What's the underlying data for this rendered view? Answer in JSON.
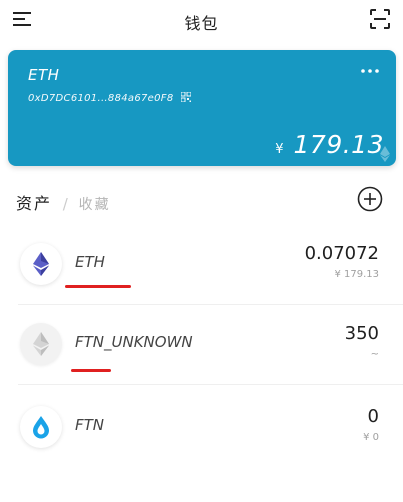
{
  "header": {
    "title": "钱包"
  },
  "wallet": {
    "name": "ETH",
    "address": "0xD7DC6101...884a67e0F8",
    "currency_symbol": "¥",
    "balance": "179.13"
  },
  "assets_section": {
    "tab_assets": "资产",
    "separator": "/",
    "tab_favorites": "收藏"
  },
  "tokens": [
    {
      "name": "ETH",
      "amount": "0.07072",
      "value": "¥  179.13",
      "icon": "ethereum-icon"
    },
    {
      "name": "FTN_UNKNOWN",
      "amount": "350",
      "value": "~",
      "icon": "ethereum-gray-icon"
    },
    {
      "name": "FTN",
      "amount": "0",
      "value": "¥  0",
      "icon": "ftn-drop-icon"
    }
  ],
  "colors": {
    "card_background": "#1798c2",
    "annotation_red": "#e02020",
    "eth_purple": "#5b5fc7",
    "ftn_blue": "#1aa3e8"
  }
}
